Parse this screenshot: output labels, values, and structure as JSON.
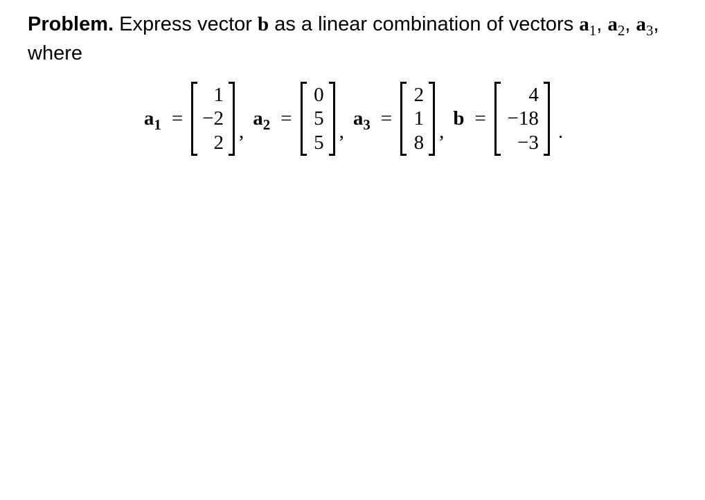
{
  "problem": {
    "heading": "Problem.",
    "text_pre": "Express vector",
    "b_sym": "b",
    "text_mid": "as a linear combination of vectors",
    "a_sym": "a",
    "sub1": "1",
    "sub2": "2",
    "sub3": "3",
    "commaSep": ",",
    "text_post": ",",
    "where": "where"
  },
  "eq": {
    "a1_label": "a",
    "a1_sub": "1",
    "a2_label": "a",
    "a2_sub": "2",
    "a3_label": "a",
    "a3_sub": "3",
    "b_label": "b",
    "equals": "=",
    "comma": ",",
    "period": "."
  },
  "vectors": {
    "a1": [
      "1",
      "−2",
      "2"
    ],
    "a2": [
      "0",
      "5",
      "5"
    ],
    "a3": [
      "2",
      "1",
      "8"
    ],
    "b": [
      "4",
      "−18",
      "−3"
    ]
  }
}
